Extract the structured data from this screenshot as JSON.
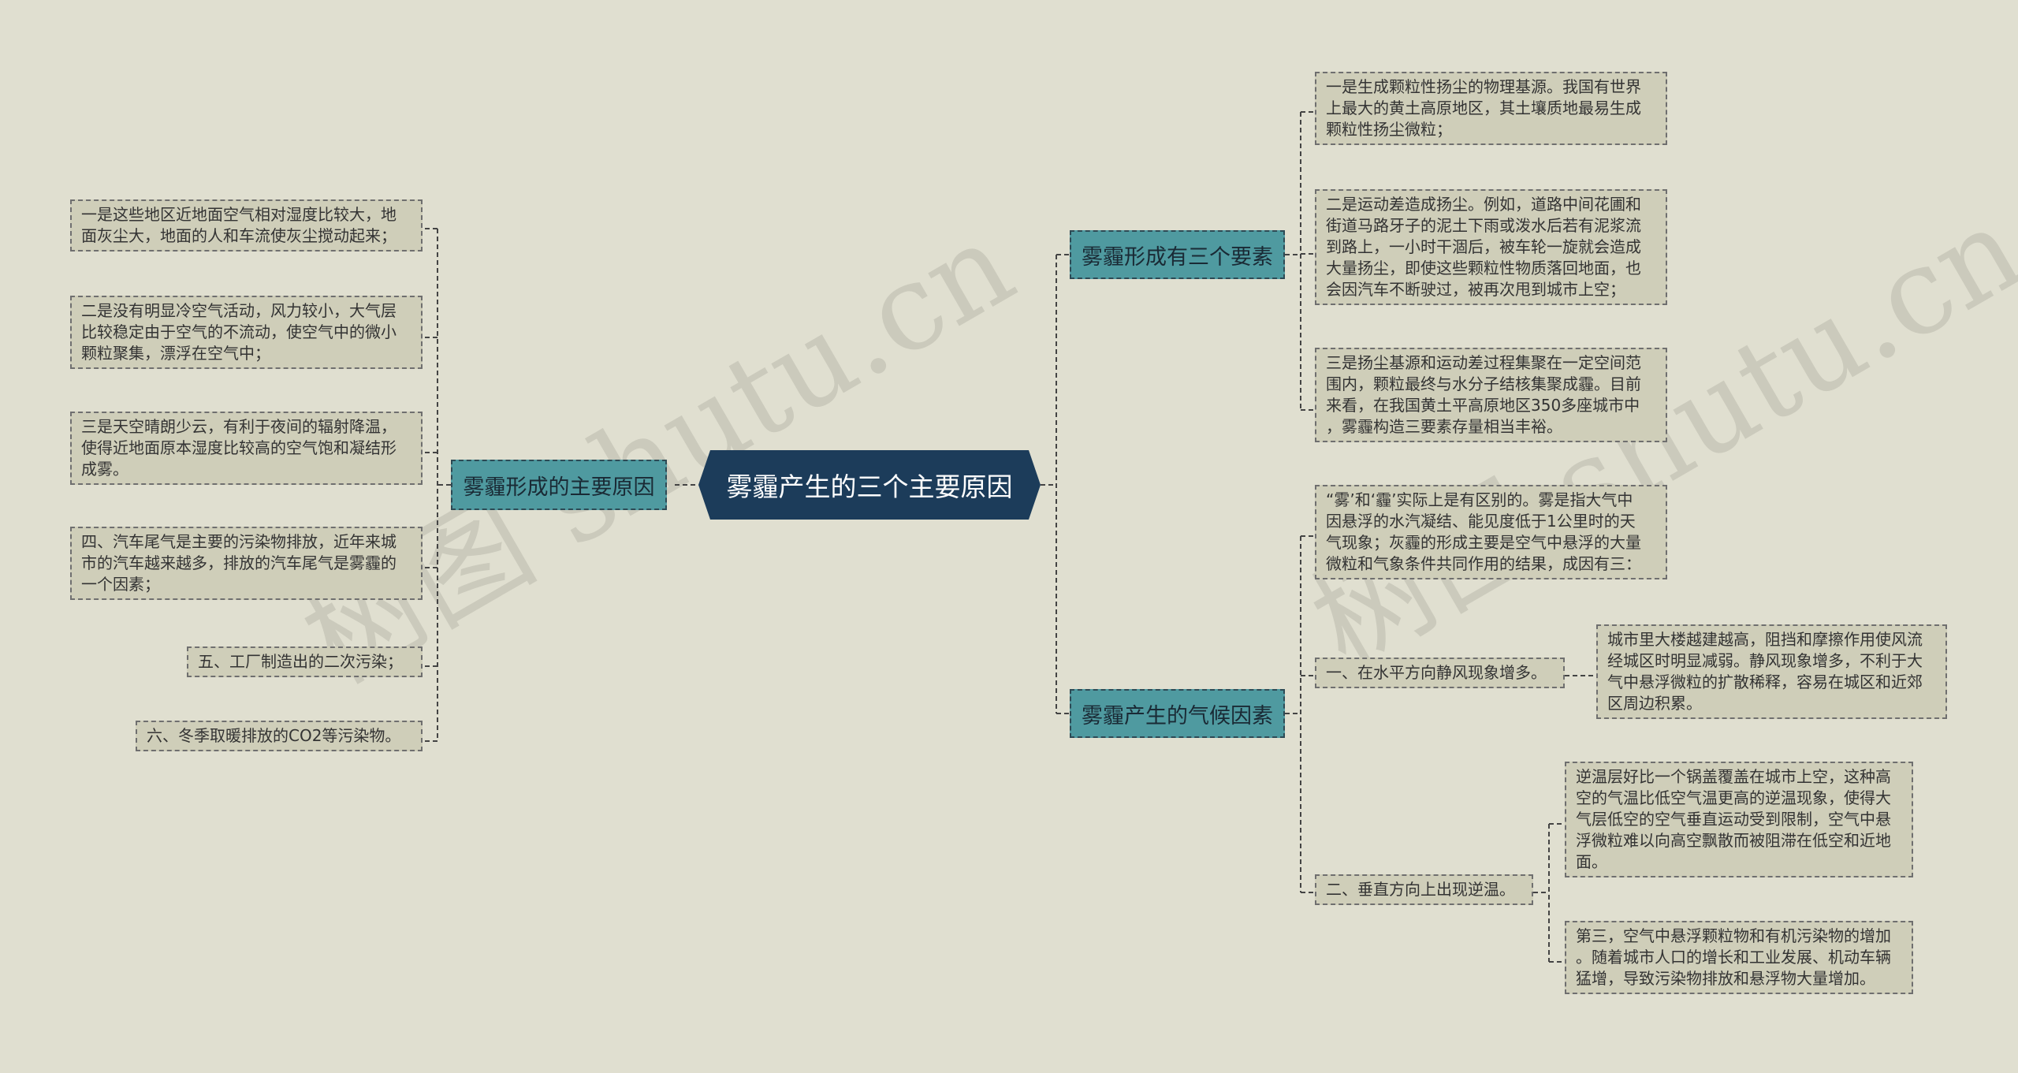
{
  "watermark": "树图 shutu.cn",
  "root": {
    "label": "雾霾产生的三个主要原因"
  },
  "left_branch": {
    "label": "雾霾形成的主要原因",
    "items": [
      [
        "一是这些地区近地面空气相对湿度比较大，地",
        "面灰尘大，地面的人和车流使灰尘搅动起来；"
      ],
      [
        "二是没有明显冷空气活动，风力较小，大气层",
        "比较稳定由于空气的不流动，使空气中的微小",
        "颗粒聚集，漂浮在空气中；"
      ],
      [
        "三是天空晴朗少云，有利于夜间的辐射降温，",
        "使得近地面原本湿度比较高的空气饱和凝结形",
        "成雾。"
      ],
      [
        "四、汽车尾气是主要的污染物排放，近年来城",
        "市的汽车越来越多，排放的汽车尾气是雾霾的",
        "一个因素；"
      ],
      [
        "五、工厂制造出的二次污染；"
      ],
      [
        "六、冬季取暖排放的CO2等污染物。"
      ]
    ]
  },
  "right_top_branch": {
    "label": "雾霾形成有三个要素",
    "items": [
      [
        "一是生成颗粒性扬尘的物理基源。我国有世界",
        "上最大的黄土高原地区，其土壤质地最易生成",
        "颗粒性扬尘微粒；"
      ],
      [
        "二是运动差造成扬尘。例如，道路中间花圃和",
        "街道马路牙子的泥土下雨或泼水后若有泥浆流",
        "到路上，一小时干涸后，被车轮一旋就会造成",
        "大量扬尘，即使这些颗粒性物质落回地面，也",
        "会因汽车不断驶过，被再次甩到城市上空；"
      ],
      [
        "三是扬尘基源和运动差过程集聚在一定空间范",
        "围内，颗粒最终与水分子结核集聚成霾。目前",
        "来看，在我国黄土平高原地区350多座城市中",
        "，雾霾构造三要素存量相当丰裕。"
      ]
    ]
  },
  "right_bottom_branch": {
    "label": "雾霾产生的气候因素",
    "intro": [
      "“雾’和‘霾’实际上是有区别的。雾是指大气中",
      "因悬浮的水汽凝结、能见度低于1公里时的天",
      "气现象；灰霾的形成主要是空气中悬浮的大量",
      "微粒和气象条件共同作用的结果，成因有三："
    ],
    "item1": {
      "label": "一、在水平方向静风现象增多。",
      "detail": [
        "城市里大楼越建越高，阻挡和摩擦作用使风流",
        "经城区时明显减弱。静风现象增多，不利于大",
        "气中悬浮微粒的扩散稀释，容易在城区和近郊",
        "区周边积累。"
      ]
    },
    "item2": {
      "label": "二、垂直方向上出现逆温。",
      "details": [
        [
          "逆温层好比一个锅盖覆盖在城市上空，这种高",
          "空的气温比低空气温更高的逆温现象，使得大",
          "气层低空的空气垂直运动受到限制，空气中悬",
          "浮微粒难以向高空飘散而被阻滞在低空和近地",
          "面。"
        ],
        [
          "第三，空气中悬浮颗粒物和有机污染物的增加",
          "。随着城市人口的增长和工业发展、机动车辆",
          "猛增，导致污染物排放和悬浮物大量增加。"
        ]
      ]
    }
  },
  "colors": {
    "background": "#e0dfd0",
    "root_fill": "#1c3c5a",
    "branch_fill": "#4f9aa0",
    "leaf_fill": "#cfceb9",
    "connector": "#444444"
  }
}
